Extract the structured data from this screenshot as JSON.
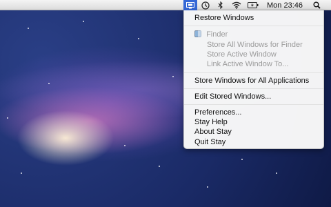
{
  "menubar": {
    "time": "Mon 23:46",
    "icons": [
      "stay-icon",
      "time-machine-icon",
      "bluetooth-icon",
      "wifi-icon",
      "battery-icon",
      "spotlight-icon"
    ]
  },
  "stay_menu": {
    "restore_windows": "Restore Windows",
    "section_app": "Finder",
    "store_all_windows_for_app": "Store All Windows for Finder",
    "store_active_window": "Store Active Window",
    "link_active_window": "Link Active Window To...",
    "store_all_apps": "Store Windows for All Applications",
    "edit_stored_windows": "Edit Stored Windows...",
    "preferences": "Preferences...",
    "help": "Stay Help",
    "about": "About Stay",
    "quit": "Quit Stay"
  },
  "colors": {
    "accent": "#3367d6",
    "disabled_text": "#9b9b9b"
  }
}
